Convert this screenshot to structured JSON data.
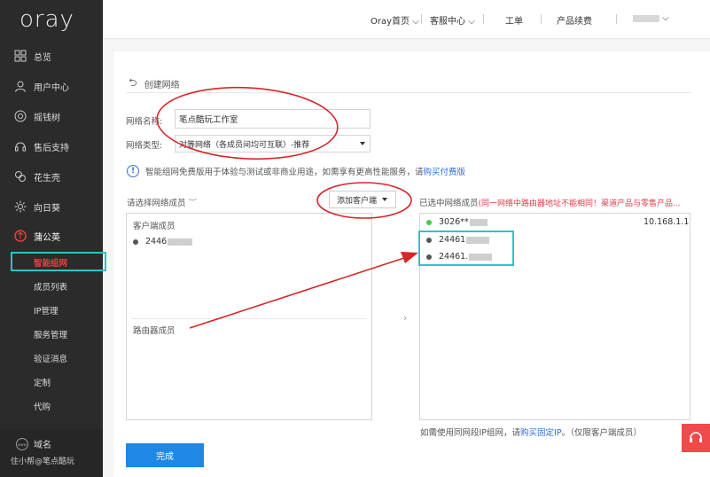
{
  "logo": "oray",
  "sidebar": {
    "items": [
      {
        "label": "总览",
        "icon": "grid-icon"
      },
      {
        "label": "用户中心",
        "icon": "user-icon"
      },
      {
        "label": "摇钱树",
        "icon": "coin-icon"
      },
      {
        "label": "售后支持",
        "icon": "headset-icon"
      },
      {
        "label": "花生壳",
        "icon": "peanut-icon"
      },
      {
        "label": "向日葵",
        "icon": "sunflower-icon"
      },
      {
        "label": "蒲公英",
        "icon": "dandelion-icon"
      }
    ],
    "sub_items": [
      "智能组网",
      "成员列表",
      "IP管理",
      "服务管理",
      "验证消息",
      "定制",
      "代购"
    ],
    "active_sub": "智能组网",
    "domain_label": "域名",
    "domain_icon_text": "www",
    "user_label": "住小帮@笔点酷玩"
  },
  "topbar": {
    "nav": [
      "Oray首页",
      "客服中心",
      "工单",
      "产品续费"
    ]
  },
  "page": {
    "back_title": "创建网络",
    "name_label": "网络名称:",
    "name_value": "笔点酷玩工作室",
    "type_label": "网络类型:",
    "type_value": "对等网络（各成员间均可互联）-推荐",
    "info_text": "智能组网免费版用于体验与测试或非商业用途，如需享有更高性能服务，请",
    "info_link": "购买付费版",
    "left_title": "请选择网络成员",
    "add_button": "添加客户端",
    "right_title": "已选中网络成员",
    "right_warning": "(同一网络中路由器地址不能相同！渠道产品与零售产品...",
    "client_label": "客户端成员",
    "client_member": "2446",
    "router_label": "路由器成员",
    "selected": [
      {
        "id": "3026**",
        "ip": "10.168.1.1",
        "online": true
      },
      {
        "id": "24461",
        "online": false
      },
      {
        "id": "24461.",
        "online": false
      }
    ],
    "bottom_note_pre": "如需使用同网段IP组网，请",
    "bottom_note_link": "购买固定IP",
    "bottom_note_post": "。（仅限客户端成员）",
    "done_button": "完成"
  },
  "colors": {
    "sidebar_bg": "#2b2b2b",
    "accent_red": "#e8413a",
    "primary_blue": "#1f87e5",
    "annotation_red": "#d6262b",
    "highlight_cyan": "#2ec4c4"
  }
}
